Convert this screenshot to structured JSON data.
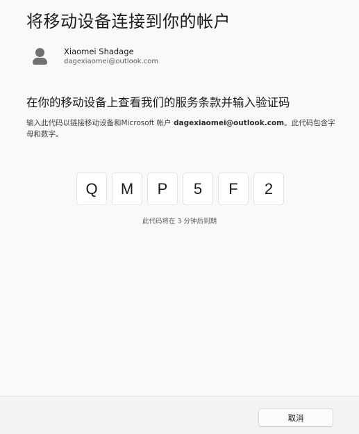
{
  "dialog": {
    "title": "将移动设备连接到你的帐户",
    "account": {
      "name": "Xiaomei Shadage",
      "email": "dagexiaomei@outlook.com"
    },
    "subtitle": "在你的移动设备上查看我们的服务条款并输入验证码",
    "description": {
      "prefix": "输入此代码以链接移动设备和Microsoft 帐户 ",
      "email": "dagexiaomei@outlook.com",
      "suffix": "。此代码包含字母和数字。"
    },
    "code": [
      "Q",
      "M",
      "P",
      "5",
      "F",
      "2"
    ],
    "expiry": "此代码将在 3 分钟后到期"
  },
  "footer": {
    "cancel_label": "取消"
  },
  "icons": {
    "avatar": "person-icon"
  }
}
